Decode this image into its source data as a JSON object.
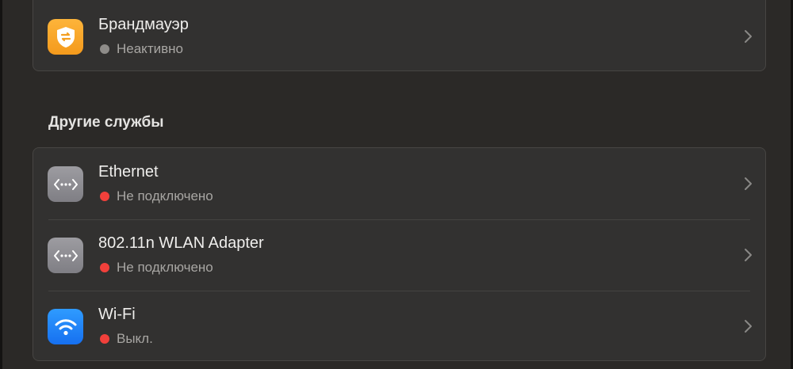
{
  "firewall": {
    "title": "Брандмауэр",
    "status": "Неактивно",
    "status_color": "#8e8c89",
    "icon": "firewall-shield-icon",
    "icon_color": "#fba92d"
  },
  "other_services": {
    "heading": "Другие службы",
    "items": [
      {
        "title": "Ethernet",
        "status": "Не подключено",
        "status_color": "#f1403b",
        "icon": "ethernet-icon"
      },
      {
        "title": "802.11n WLAN Adapter",
        "status": "Не подключено",
        "status_color": "#f1403b",
        "icon": "ethernet-icon"
      },
      {
        "title": "Wi-Fi",
        "status": "Выкл.",
        "status_color": "#f1403b",
        "icon": "wifi-icon",
        "icon_color": "#1f86fb"
      }
    ]
  }
}
